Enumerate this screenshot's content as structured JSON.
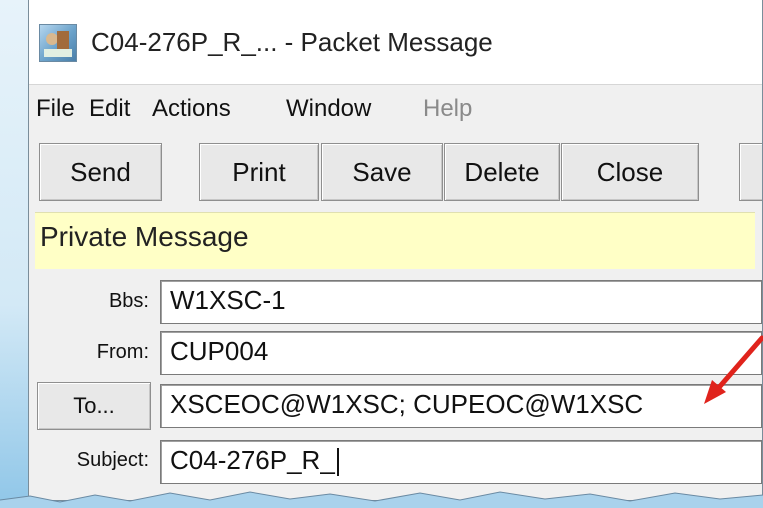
{
  "window": {
    "title": "C04-276P_R_... - Packet Message"
  },
  "menu": {
    "items": [
      {
        "label": "File",
        "disabled": false
      },
      {
        "label": "Edit",
        "disabled": false
      },
      {
        "label": "Actions",
        "disabled": false
      },
      {
        "label": "Window",
        "disabled": false
      },
      {
        "label": "Help",
        "disabled": true
      }
    ]
  },
  "toolbar": {
    "send": "Send",
    "print": "Print",
    "save": "Save",
    "delete": "Delete",
    "close": "Close"
  },
  "banner": {
    "text": "Private Message"
  },
  "form": {
    "bbs_label": "Bbs:",
    "bbs_value": "W1XSC-1",
    "from_label": "From:",
    "from_value": "CUP004",
    "to_button": "To...",
    "to_value": "XSCEOC@W1XSC; CUPEOC@W1XSC",
    "subject_label": "Subject:",
    "subject_value": "C04-276P_R_"
  },
  "colors": {
    "banner": "#ffffc6",
    "arrow": "#e0231c"
  }
}
